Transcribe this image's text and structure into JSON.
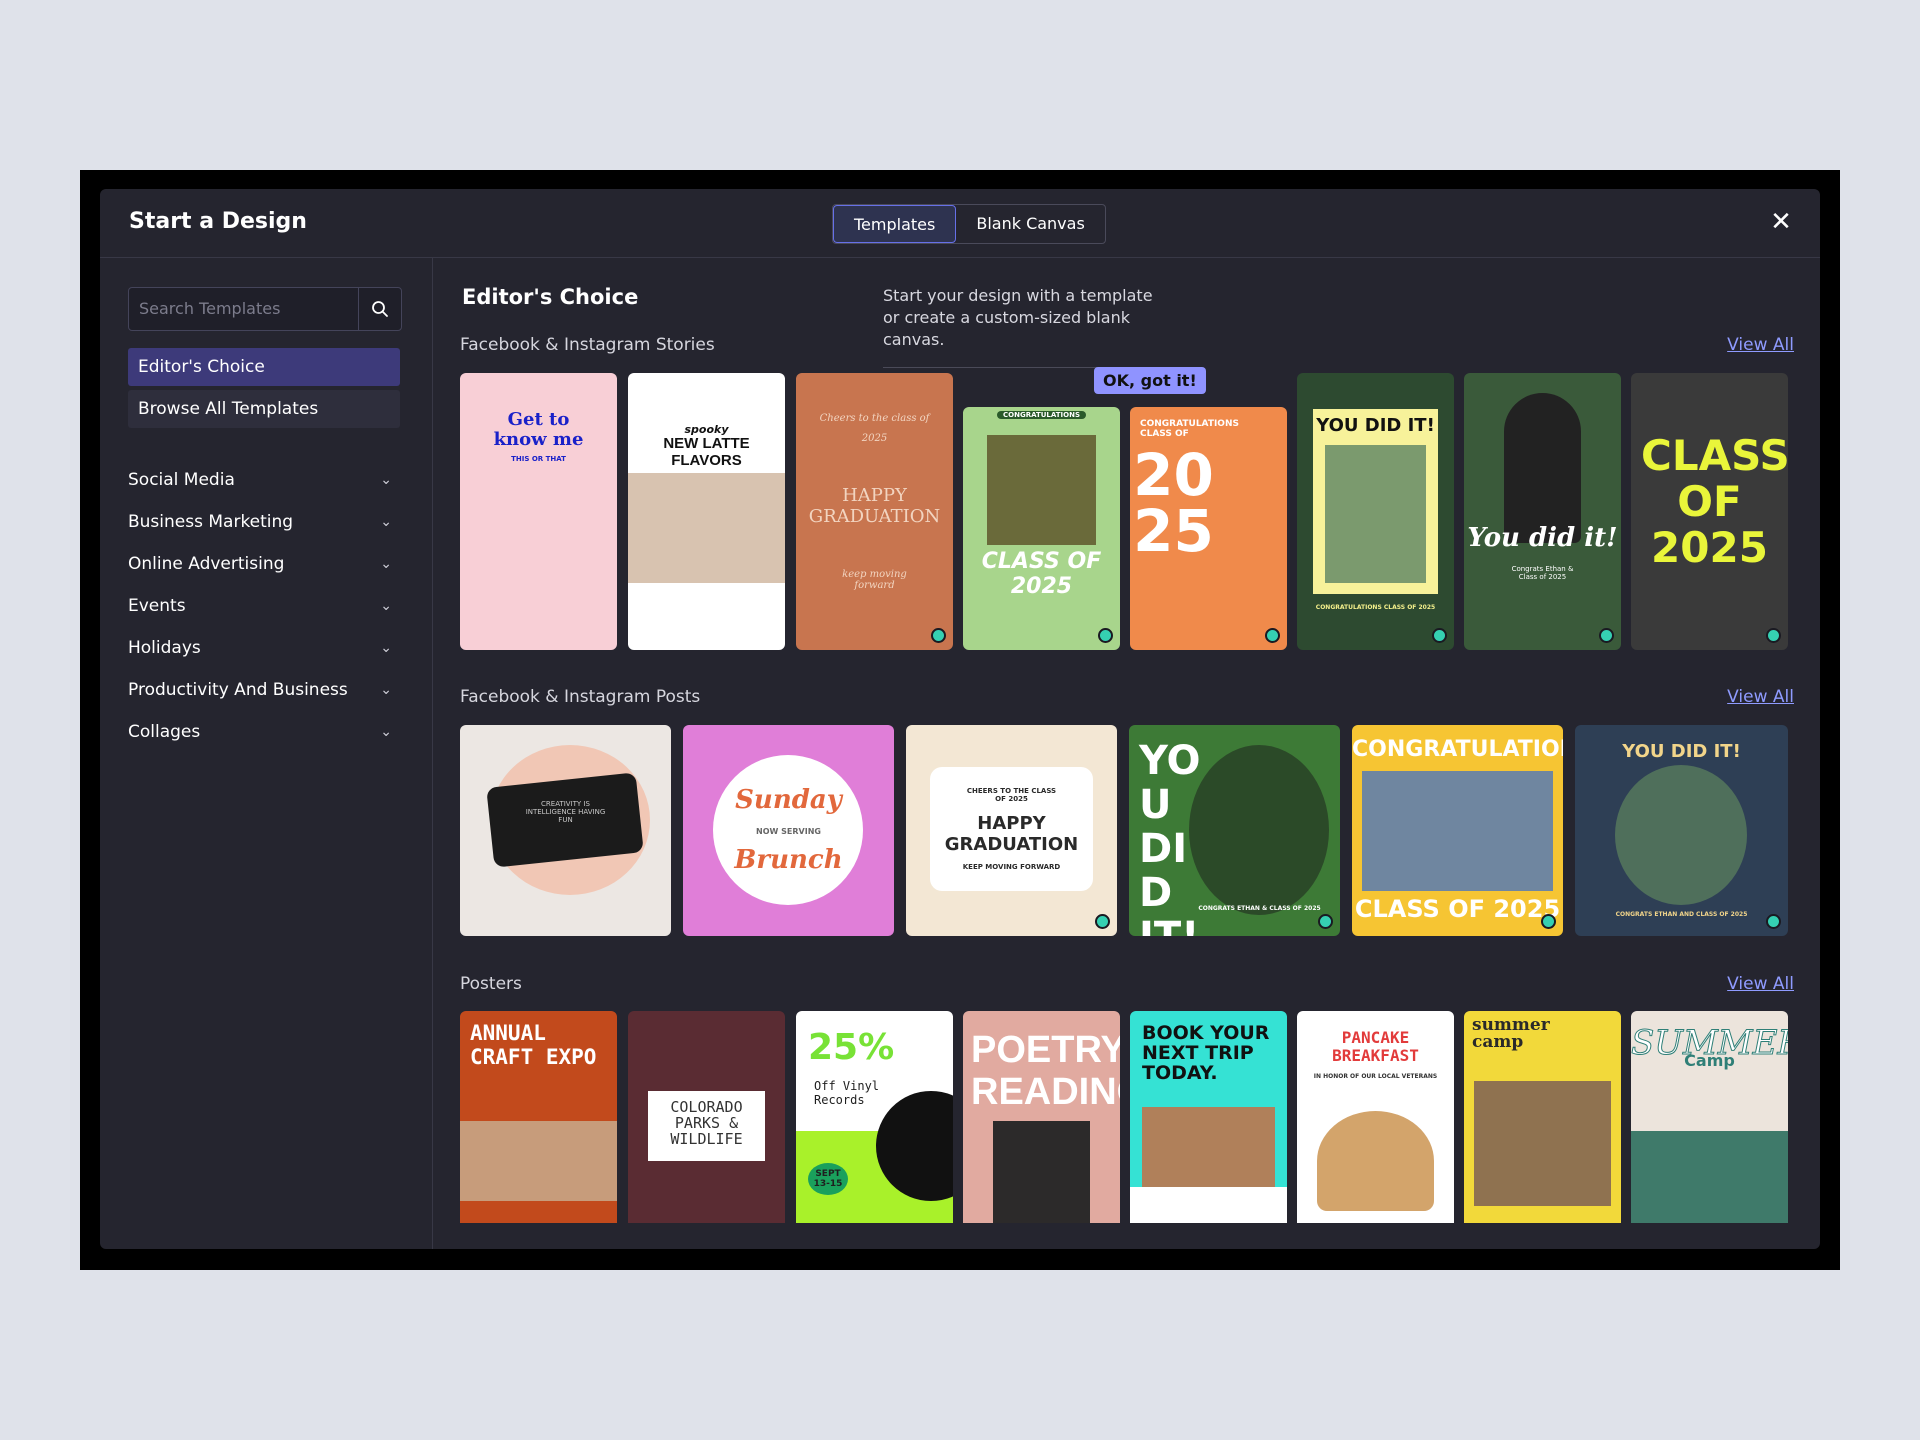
{
  "modal": {
    "title": "Start a Design",
    "tabs": [
      "Templates",
      "Blank Canvas"
    ],
    "active_tab": "Templates",
    "close_icon": "close-icon"
  },
  "sidebar": {
    "search_placeholder": "Search Templates",
    "nav": [
      "Editor's Choice",
      "Browse All Templates"
    ],
    "categories": [
      "Social Media",
      "Business Marketing",
      "Online Advertising",
      "Events",
      "Holidays",
      "Productivity And Business",
      "Collages"
    ]
  },
  "main": {
    "heading": "Editor's Choice",
    "tip": "Start your design with a template or create a custom-sized blank canvas.",
    "tip_button": "OK, got it!",
    "view_all": "View All",
    "sections": [
      "Facebook & Instagram Stories",
      "Facebook & Instagram Posts",
      "Posters"
    ]
  },
  "stories": [
    {
      "line1": "Get to",
      "line2": "know me",
      "line3": "THIS OR THAT",
      "colors": {
        "bg": "#f8cfd6",
        "fg": "#1a21c9"
      }
    },
    {
      "line1": "NEW LATTE FLAVORS",
      "line2": "spooky",
      "colors": {
        "bg": "#ffffff",
        "fg": "#111111"
      }
    },
    {
      "line1": "Cheers to the class of",
      "line2": "2025",
      "line3": "HAPPY GRADUATION",
      "line4": "keep moving forward",
      "colors": {
        "bg": "#c8754f",
        "fg": "#f2d4c0"
      }
    },
    {
      "line1": "CONGRATULATIONS",
      "line2": "CLASS OF 2025",
      "colors": {
        "bg": "#a8d58c",
        "fg": "#ffffff"
      }
    },
    {
      "line1": "CONGRATULATIONS CLASS OF",
      "line2": "2025",
      "colors": {
        "bg": "#f08a4b",
        "fg": "#ffffff"
      }
    },
    {
      "line1": "YOU DID IT!",
      "line2": "CONGRATULATIONS CLASS OF 2025",
      "colors": {
        "bg": "#2d4a30",
        "fg": "#f4f08c"
      }
    },
    {
      "line1": "You did it!",
      "line2": "Congrats Ethan & Class of 2025",
      "colors": {
        "bg": "#3a5a3a",
        "fg": "#ffffff"
      }
    },
    {
      "line1": "CLASS OF 2025",
      "colors": {
        "bg": "#3a3a3a",
        "fg": "#e9f53a"
      }
    }
  ],
  "posts": [
    {
      "line1": "CREATIVITY IS INTELLIGENCE HAVING FUN",
      "colors": {
        "bg": "#ece7e3",
        "fg": "#c8c8c8"
      }
    },
    {
      "line1": "Sunday",
      "line2": "NOW SERVING",
      "line3": "Brunch",
      "colors": {
        "bg": "#e07ed8",
        "fg": "#e2683c"
      }
    },
    {
      "line1": "CHEERS TO THE CLASS OF 2025",
      "line2": "HAPPY GRADUATION",
      "line3": "KEEP MOVING FORWARD",
      "colors": {
        "bg": "#f3e7d4",
        "fg": "#2a2a2a"
      }
    },
    {
      "line1": "YOU DID IT!",
      "line2": "CONGRATS ETHAN & CLASS OF 2025",
      "colors": {
        "bg": "#3d7a36",
        "fg": "#ffffff"
      }
    },
    {
      "line1": "CONGRATULATIONS",
      "line2": "CLASS OF 2025",
      "colors": {
        "bg": "#f6c533",
        "fg": "#ffffff"
      }
    },
    {
      "line1": "YOU DID IT!",
      "line2": "CONGRATS ETHAN AND CLASS OF 2025",
      "colors": {
        "bg": "#2e3f55",
        "fg": "#f2d58a"
      }
    }
  ],
  "posters": [
    {
      "line1": "ANNUAL CRAFT EXPO",
      "colors": {
        "bg": "#c24a1c",
        "fg": "#ffffff"
      }
    },
    {
      "line1": "COLORADO PARKS & WILDLIFE",
      "colors": {
        "bg": "#5a2c33",
        "fg": "#333333"
      }
    },
    {
      "line1": "25%",
      "line2": "Off Vinyl Records",
      "line3": "SEPT 13-15",
      "colors": {
        "bg": "#ffffff",
        "fg": "#1f1f1f"
      }
    },
    {
      "line1": "POETRY READING",
      "colors": {
        "bg": "#e1aaa0",
        "fg": "#ffffff"
      }
    },
    {
      "line1": "BOOK YOUR NEXT TRIP TODAY.",
      "colors": {
        "bg": "#35e2d4",
        "fg": "#111111"
      }
    },
    {
      "line1": "PANCAKE BREAKFAST",
      "line2": "IN HONOR OF OUR LOCAL VETERANS",
      "colors": {
        "bg": "#ffffff",
        "fg": "#e23b3b"
      }
    },
    {
      "line1": "summer camp",
      "colors": {
        "bg": "#f2d93a",
        "fg": "#2a2a2a"
      }
    },
    {
      "line1": "SUMMER",
      "line2": "Camp",
      "colors": {
        "bg": "#ece4dc",
        "fg": "#2f7f77"
      }
    }
  ]
}
